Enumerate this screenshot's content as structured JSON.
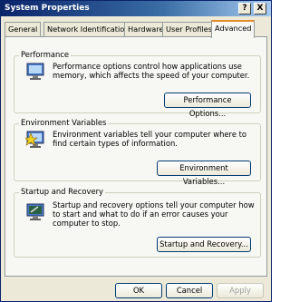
{
  "window": {
    "title": "System Properties",
    "help_btn": "?",
    "close_btn": "X"
  },
  "tabs": [
    "General",
    "Network Identification",
    "Hardware",
    "User Profiles",
    "Advanced"
  ],
  "groups": {
    "performance": {
      "label": "Performance",
      "desc": "Performance options control how applications use memory, which affects the speed of your computer.",
      "button": "Performance Options...",
      "icon": "monitor-icon"
    },
    "environment": {
      "label": "Environment Variables",
      "desc": "Environment variables tell your computer where to find certain types of information.",
      "button": "Environment Variables...",
      "icon": "monitor-star-icon"
    },
    "startup": {
      "label": "Startup and Recovery",
      "desc": "Startup and recovery options tell your computer how to start and what to do if an error causes your computer to stop.",
      "button": "Startup and Recovery...",
      "icon": "monitor-wrench-icon"
    }
  },
  "footer": {
    "ok": "OK",
    "cancel": "Cancel",
    "apply": "Apply"
  },
  "colors": {
    "titlebar": "#0a246a",
    "dialog": "#ece9d8",
    "active_tab_accent": "#e68b2c"
  }
}
